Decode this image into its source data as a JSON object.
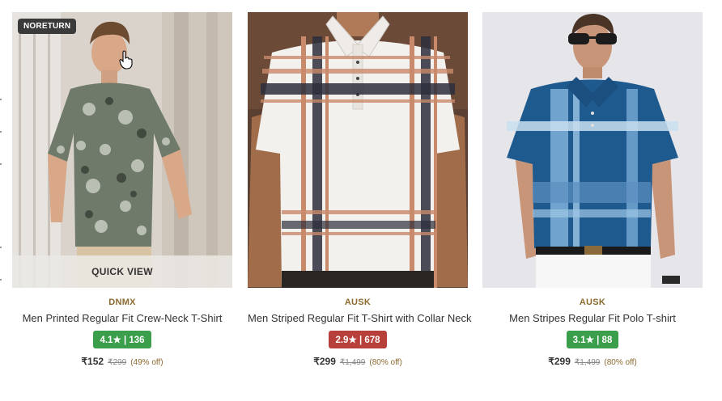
{
  "products": [
    {
      "badge": "NORETURN",
      "quick_view": "QUICK VIEW",
      "brand": "DNMX",
      "title": "Men Printed Regular Fit Crew-Neck T-Shirt",
      "rating": "4.1★ | 136",
      "rating_color": "#3a9e4a",
      "price": "₹152",
      "mrp": "₹299",
      "discount": "(49% off)"
    },
    {
      "brand": "AUSK",
      "title": "Men Striped Regular Fit T-Shirt with Collar Neck",
      "rating": "2.9★ | 678",
      "rating_color": "#b8403a",
      "price": "₹299",
      "mrp": "₹1,499",
      "discount": "(80% off)"
    },
    {
      "brand": "AUSK",
      "title": "Men Stripes Regular Fit Polo T-shirt",
      "rating": "3.1★ | 88",
      "rating_color": "#3a9e4a",
      "price": "₹299",
      "mrp": "₹1,499",
      "discount": "(80% off)"
    }
  ]
}
